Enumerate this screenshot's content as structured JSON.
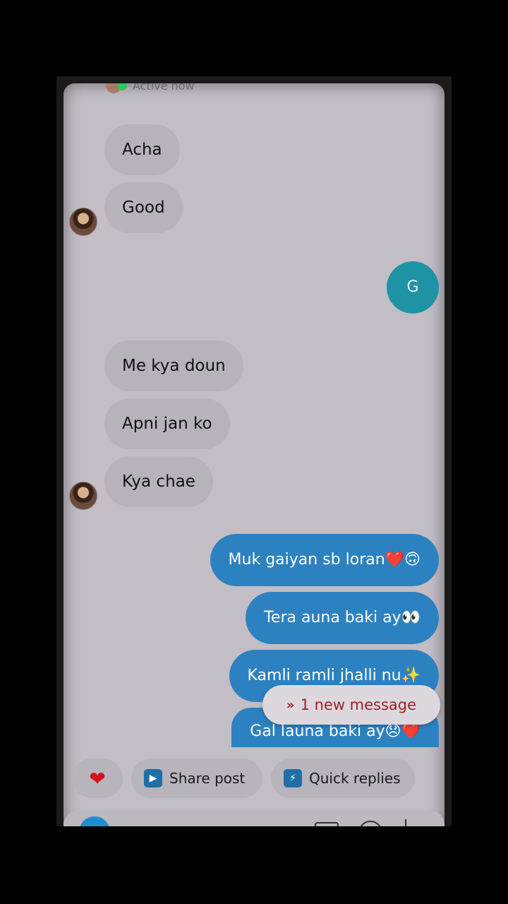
{
  "header": {
    "status_text": "Active now"
  },
  "messages_in_top": [
    {
      "text": "Acha"
    },
    {
      "text": "Good"
    }
  ],
  "outgoing_single": {
    "text": "G"
  },
  "messages_in_mid": [
    {
      "text": "Me kya doun"
    },
    {
      "text": "Apni jan ko"
    },
    {
      "text": "Kya chae"
    }
  ],
  "messages_out": [
    {
      "text": "Muk gaiyan sb loran❤️🙃"
    },
    {
      "text": "Tera auna baki ay👀"
    },
    {
      "text": "Kamli ramli jhalli nu✨"
    },
    {
      "text": "Gal launa baki ay😞❤️"
    }
  ],
  "new_message_pill": {
    "label": "1 new message",
    "icon": "chevron-double-down-icon",
    "color": "#a11f28"
  },
  "actions": {
    "like_icon": "heart-icon",
    "share_label": "Share post",
    "quick_label": "Quick replies"
  },
  "colors": {
    "incoming_bubble": "#b8b2bb",
    "outgoing_bubble": "#2c82c0",
    "background": "#c3bdc6"
  }
}
